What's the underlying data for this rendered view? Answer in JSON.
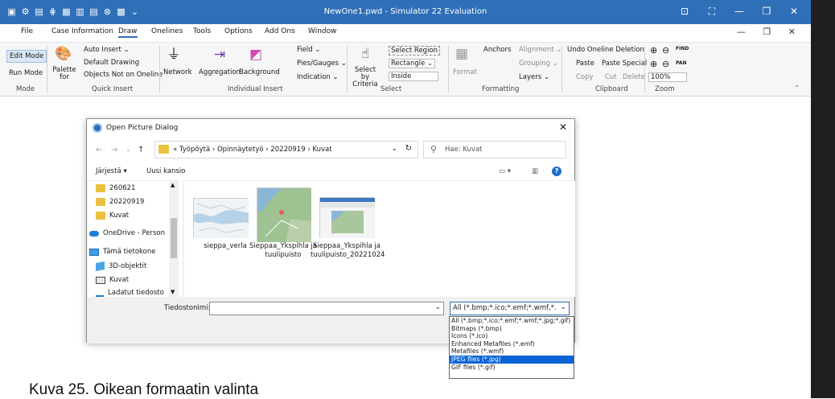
{
  "window": {
    "title": "NewOne1.pwd - Simulator 22 Evaluation",
    "controls": [
      "⊡",
      "⛶",
      "—",
      "❐",
      "✕"
    ]
  },
  "menubar": {
    "items": [
      "File",
      "Case Information",
      "Draw",
      "Onelines",
      "Tools",
      "Options",
      "Add Ons",
      "Window"
    ],
    "active": "Draw",
    "mdi_controls": "— ❐ ✕"
  },
  "ribbon": {
    "mode": {
      "edit": "Edit Mode",
      "run": "Run Mode",
      "group": "Mode"
    },
    "quick_insert": {
      "palette": "Palette for",
      "auto_insert": "Auto Insert ⌄",
      "default_drawing": "Default Drawing",
      "objects_not_on_oneline": "Objects Not on Oneline",
      "group": "Quick Insert"
    },
    "individual_insert": {
      "network": "Network",
      "aggregation": "Aggregation",
      "background": "Background",
      "field": "Field ⌄",
      "pies_gauges": "Pies/Gauges ⌄",
      "indication": "Indication ⌄",
      "group": "Individual Insert"
    },
    "select": {
      "select_by_criteria": "Select by Criteria",
      "select_region": "Select Region",
      "rectangle": "Rectangle ⌄",
      "inside": "Inside",
      "group": "Select"
    },
    "formatting": {
      "format": "Format",
      "anchors": "Anchors",
      "alignment": "Alignment ⌄",
      "grouping": "Grouping ⌄",
      "layers": "Layers ⌄",
      "group": "Formatting"
    },
    "clipboard": {
      "undo": "Undo Oneline Deletion",
      "paste": "Paste",
      "paste_special": "Paste Special",
      "copy": "Copy",
      "cut": "Cut",
      "delete": "Delete",
      "group": "Clipboard"
    },
    "zoom": {
      "find": "FIND",
      "pan": "PAN",
      "value": "100%",
      "group": "Zoom"
    }
  },
  "dialog": {
    "title": "Open Picture Dialog",
    "breadcrumb": "« Työpöytä  ›  Opinnäytetyö  ›  20220919  ›  Kuvat",
    "search_placeholder": "Hae: Kuvat",
    "organize": "Järjestä ▾",
    "new_folder": "Uusi kansio",
    "nav_items": [
      {
        "label": "260621"
      },
      {
        "label": "20220919"
      },
      {
        "label": "Kuvat"
      },
      {
        "label": "OneDrive - Person"
      },
      {
        "label": "Tämä tietokone"
      },
      {
        "label": "3D-objektit"
      },
      {
        "label": "Kuvat"
      },
      {
        "label": "Ladatut tiedosto"
      }
    ],
    "files": [
      {
        "name": "sieppa_verla"
      },
      {
        "name": "Sieppaa_Ykspihla ja tuulipuisto"
      },
      {
        "name": "Sieppaa_Ykspihla ja tuulipuisto_20221024"
      }
    ],
    "filename_label": "Tiedostonimi:",
    "filename_value": "",
    "filter_value": "All (*.bmp;*.ico;*.emf;*.wmf,*.jp",
    "filter_options": [
      "All (*.bmp;*.ico;*.emf;*.wmf;*.jpg;*.gif)",
      "Bitmaps (*.bmp)",
      "Icons (*.ico)",
      "Enhanced Metafiles (*.emf)",
      "Metafiles (*.wmf)",
      "JPEG files (*.jpg)",
      "GIF files (*.gif)"
    ],
    "selected_option_index": 5
  },
  "caption": "Kuva 25. Oikean formaatin valinta",
  "colors": {
    "titlebar": "#2f6fb7",
    "selection": "#0a64d8"
  }
}
